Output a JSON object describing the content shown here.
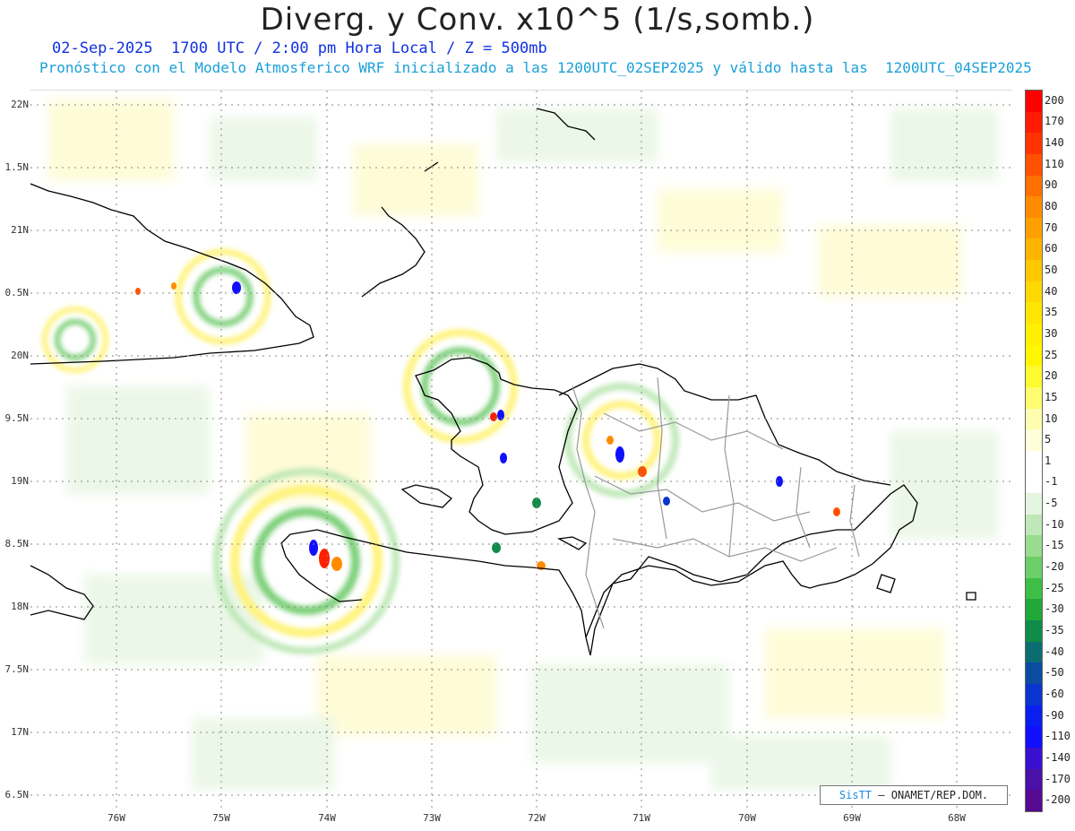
{
  "title": "Diverg. y Conv. x10^5 (1/s,somb.)",
  "subtitle_time": "02-Sep-2025  1700 UTC / 2:00 pm Hora Local / Z = 500mb",
  "subtitle_model": "Pronóstico con el Modelo Atmosferico WRF inicializado a las 1200UTC_02SEP2025 y válido hasta las  1200UTC_04SEP2025",
  "lat_labels": [
    "22N",
    "1.5N",
    "21N",
    "0.5N",
    "20N",
    "9.5N",
    "19N",
    "8.5N",
    "18N",
    "7.5N",
    "17N",
    "6.5N"
  ],
  "lon_labels": [
    "76W",
    "75W",
    "74W",
    "73W",
    "72W",
    "71W",
    "70W",
    "69W",
    "68W"
  ],
  "colorbar": {
    "labels": [
      "200",
      "170",
      "140",
      "110",
      "90",
      "80",
      "70",
      "60",
      "50",
      "40",
      "35",
      "30",
      "25",
      "20",
      "15",
      "10",
      "5",
      "1",
      "-1",
      "-5",
      "-10",
      "-15",
      "-20",
      "-25",
      "-30",
      "-35",
      "-40",
      "-50",
      "-60",
      "-90",
      "-110",
      "-140",
      "-170",
      "-200"
    ],
    "colors": [
      "#ff0000",
      "#ff1a00",
      "#ff3300",
      "#ff5200",
      "#ff7000",
      "#ff8c00",
      "#ffa000",
      "#ffb400",
      "#ffc800",
      "#ffd800",
      "#ffe600",
      "#fff000",
      "#fff600",
      "#fffa30",
      "#fffc70",
      "#fffdb0",
      "#fffed8",
      "#ffffff",
      "#ffffff",
      "#e4f5e0",
      "#bfe8b8",
      "#98dc90",
      "#6ccf68",
      "#3fbe45",
      "#20a838",
      "#108c48",
      "#0a6e70",
      "#0a4ca0",
      "#0a34d0",
      "#0a1ef0",
      "#1010ff",
      "#3a10d0",
      "#4a10a8",
      "#550a90"
    ]
  },
  "credit": {
    "brand": "SisTT",
    "text": "– ONAMET/REP.DOM."
  },
  "colors": {
    "land_outline": "#000000",
    "borders": "#999999",
    "grid": "#888888",
    "title": "#222222",
    "subtitle_time": "#1030e0",
    "subtitle_model": "#1aa0d8"
  }
}
